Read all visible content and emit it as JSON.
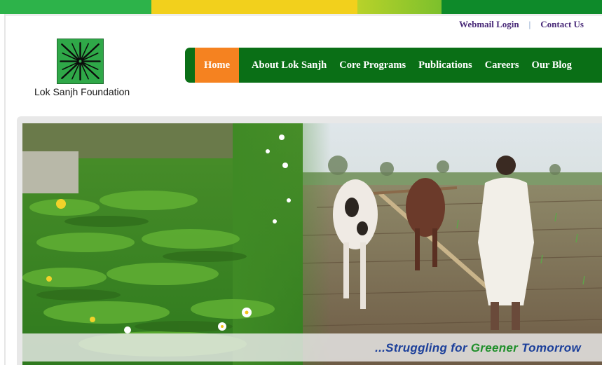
{
  "colors": {
    "stripe": [
      "#2db34a",
      "#f2d01c",
      "#9ccc2c",
      "#0e8a2a"
    ],
    "nav_bg": "#0a6f16",
    "nav_active": "#f58220",
    "logo_bg": "#2fa848",
    "link": "#4b2c7a",
    "tagline_blue": "#1b3f9a",
    "tagline_green": "#1f8f2a"
  },
  "utility": {
    "webmail": "Webmail Login",
    "separator": "|",
    "contact": "Contact Us"
  },
  "logo": {
    "name": "Lok Sanjh Foundation"
  },
  "nav": {
    "items": [
      {
        "label": "Home"
      },
      {
        "label": "About Lok Sanjh"
      },
      {
        "label": "Core Programs"
      },
      {
        "label": "Publications"
      },
      {
        "label": "Careers"
      },
      {
        "label": "Our Blog"
      }
    ]
  },
  "banner": {
    "tagline_prefix": "...Struggling for ",
    "tagline_green": "Greener",
    "tagline_suffix": " Tomorrow"
  }
}
